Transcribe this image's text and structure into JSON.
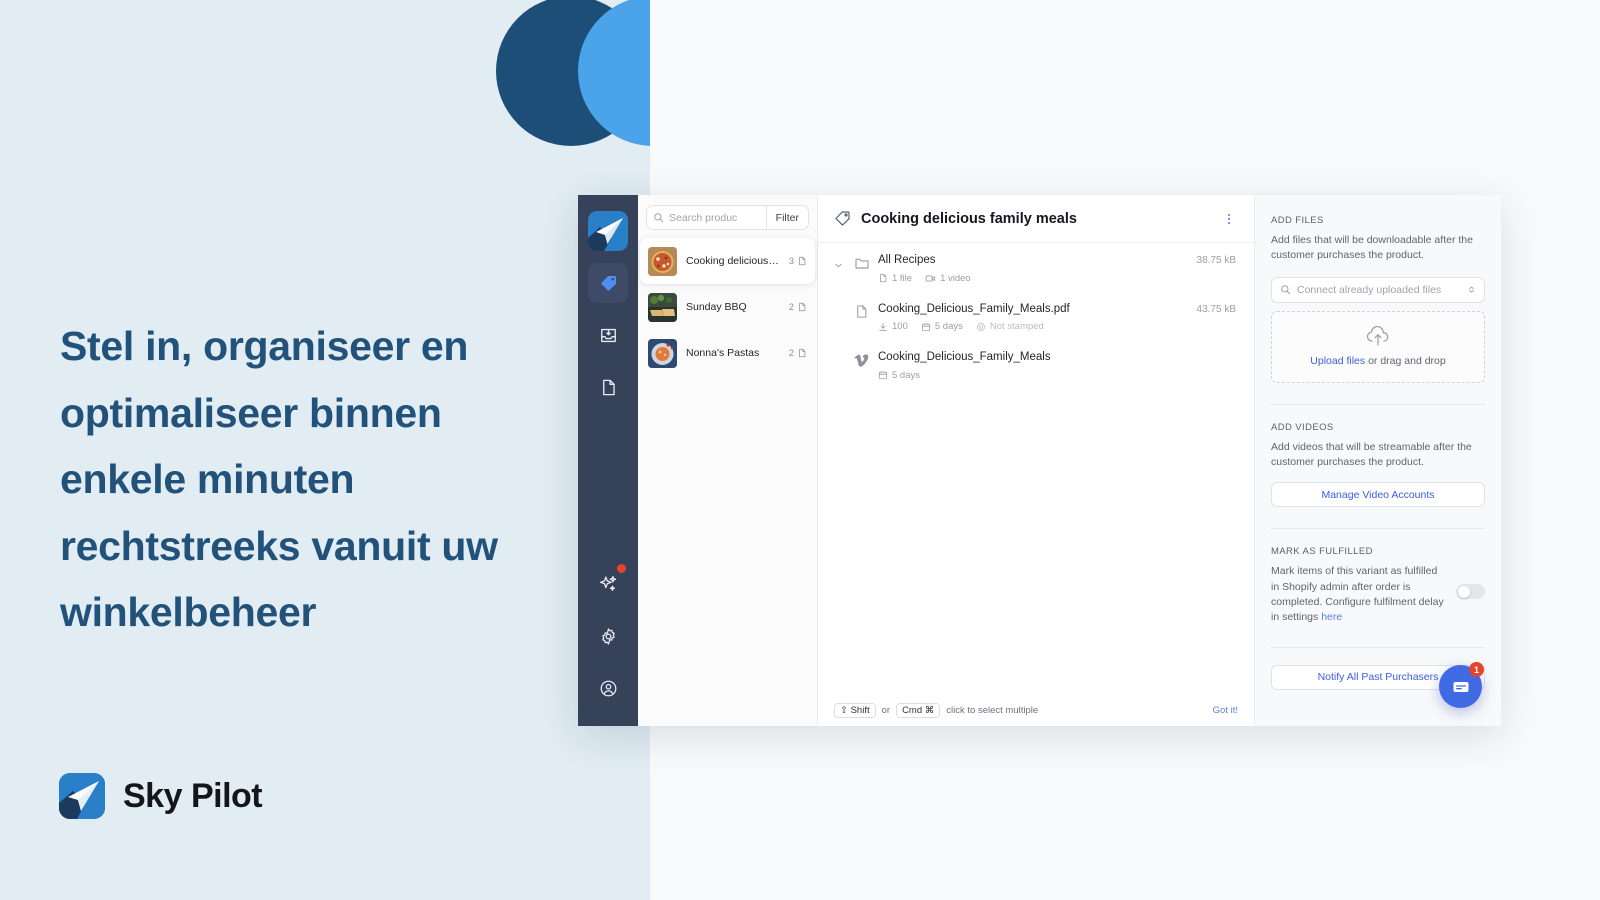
{
  "marketing": {
    "headline": "Stel in, organiseer en optimaliseer binnen enkele minuten rechtstreeks vanuit uw winkelbeheer",
    "brand_name": "Sky Pilot",
    "accent_dark": "#1d4e78",
    "accent_light": "#4ba3ea",
    "background": "#e1ecf3"
  },
  "app": {
    "rail": [
      {
        "name": "logo",
        "icon": "sky-pilot-logo-icon",
        "active": false
      },
      {
        "name": "products",
        "icon": "tag-icon",
        "active": true
      },
      {
        "name": "downloads",
        "icon": "inbox-download-icon",
        "active": false
      },
      {
        "name": "pages",
        "icon": "page-icon",
        "active": false
      },
      {
        "name": "magic",
        "icon": "sparkles-icon",
        "active": false,
        "badge": true
      },
      {
        "name": "settings",
        "icon": "gear-icon",
        "active": false
      },
      {
        "name": "account",
        "icon": "user-circle-icon",
        "active": false
      }
    ],
    "search": {
      "placeholder": "Search produc",
      "icon": "search-icon",
      "filter_label": "Filter"
    },
    "products": [
      {
        "title": "Cooking delicious f...",
        "count": "3",
        "selected": true,
        "thumb": "pizza-photo"
      },
      {
        "title": "Sunday BBQ",
        "count": "2",
        "selected": false,
        "thumb": "bbq-photo"
      },
      {
        "title": "Nonna's Pastas",
        "count": "2",
        "selected": false,
        "thumb": "pasta-photo"
      }
    ],
    "detail": {
      "title": "Cooking delicious family meals",
      "title_icon": "tag-icon",
      "menu_icon": "kebab-menu-icon",
      "rows": [
        {
          "name": "All Recipes",
          "icon": "folder-icon",
          "expandable": true,
          "size": "38.75 kB",
          "meta": [
            {
              "icon": "file-icon",
              "text": "1 file"
            },
            {
              "icon": "video-icon",
              "text": "1 video"
            }
          ]
        },
        {
          "name": "Cooking_Delicious_Family_Meals.pdf",
          "icon": "file-icon",
          "expandable": false,
          "size": "43.75 kB",
          "meta": [
            {
              "icon": "download-icon",
              "text": "100"
            },
            {
              "icon": "calendar-icon",
              "text": "5 days"
            },
            {
              "icon": "stamp-icon",
              "text": "Not stamped",
              "dim": true
            }
          ]
        },
        {
          "name": "Cooking_Delicious_Family_Meals",
          "icon": "vimeo-icon",
          "expandable": false,
          "size": "",
          "meta": [
            {
              "icon": "calendar-icon",
              "text": "5 days"
            }
          ]
        }
      ],
      "hint": {
        "key_shift": "⇧ Shift",
        "or": "or",
        "key_cmd": "Cmd ⌘",
        "text": "click to select multiple",
        "dismiss": "Got it!"
      }
    },
    "settings_panel": {
      "add_files": {
        "title": "ADD FILES",
        "description": "Add files that will be downloadable after the customer purchases the product.",
        "connect_placeholder": "Connect already uploaded files",
        "connect_icon": "search-icon",
        "stepper_icon": "chevron-updown-icon",
        "dropzone_icon": "cloud-upload-icon",
        "upload_link": "Upload files",
        "dropzone_suffix": " or drag and drop"
      },
      "add_videos": {
        "title": "ADD VIDEOS",
        "description": "Add videos that will be streamable after the customer purchases the product.",
        "button": "Manage Video Accounts"
      },
      "mark_fulfilled": {
        "title": "MARK AS FULFILLED",
        "description": "Mark items of this variant as fulfilled in Shopify admin after order is completed. Configure fulfilment delay in settings ",
        "link": "here",
        "toggle_on": false
      },
      "notify_button": "Notify All Past Purchasers"
    },
    "chat": {
      "icon": "chat-bubble-icon",
      "badge": "1",
      "color": "#4069e4"
    }
  }
}
